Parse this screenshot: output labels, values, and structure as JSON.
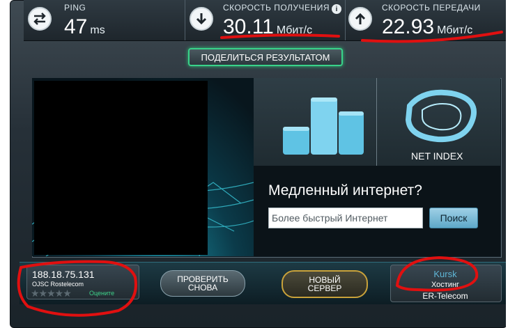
{
  "ping": {
    "label": "PING",
    "value": "47",
    "unit": "ms"
  },
  "download": {
    "label": "СКОРОСТЬ ПОЛУЧЕНИЯ",
    "value": "30.11",
    "unit": "Мбит/с",
    "info_glyph": "i"
  },
  "upload": {
    "label": "СКОРОСТЬ ПЕРЕДАЧИ",
    "value": "22.93",
    "unit": "Мбит/с"
  },
  "share_button": {
    "label": "ПОДЕЛИТЬСЯ РЕЗУЛЬТАТОМ"
  },
  "net_index": {
    "label": "NET INDEX"
  },
  "slow_internet": {
    "title": "Медленный интернет?",
    "input_value": "Более быстрый Интернет",
    "search_label": "Поиск"
  },
  "client": {
    "ip": "188.18.75.131",
    "isp": "OJSC Rostelecom",
    "stars": "★★★★★",
    "rate_label": "Оцените"
  },
  "actions": {
    "retest_line1": "ПРОВЕРИТЬ",
    "retest_line2": "СНОВА",
    "new_server_line1": "НОВЫЙ",
    "new_server_line2": "СЕРВЕР"
  },
  "server": {
    "city": "Kursk",
    "host_label": "Хостинг",
    "host": "ER-Telecom"
  },
  "colors": {
    "accent_green": "#39d38a",
    "accent_gold": "#c9a23a",
    "annotation_red": "#e01010"
  },
  "icons": [
    "ping-swap-icon",
    "download-arrow-icon",
    "upload-arrow-icon",
    "info-icon",
    "bar-chart-icon",
    "net-index-ring-icon",
    "rating-star-icon"
  ]
}
